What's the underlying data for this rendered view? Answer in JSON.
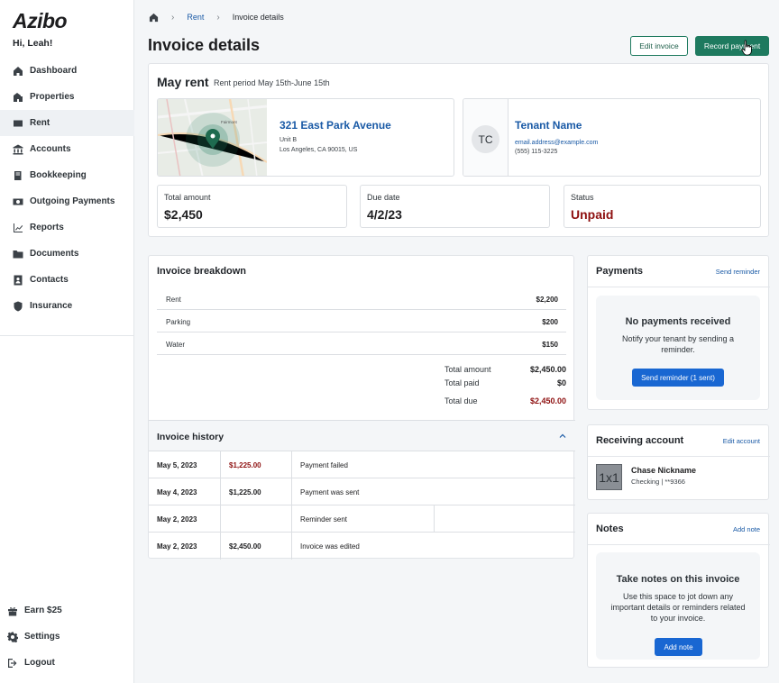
{
  "app": {
    "logo": "Azibo",
    "greeting": "Hi, Leah!"
  },
  "sidebar": {
    "items": [
      {
        "label": "Dashboard",
        "icon": "home-icon"
      },
      {
        "label": "Properties",
        "icon": "building-icon"
      },
      {
        "label": "Rent",
        "icon": "card-icon",
        "active": true
      },
      {
        "label": "Accounts",
        "icon": "bank-icon"
      },
      {
        "label": "Bookkeeping",
        "icon": "book-icon"
      },
      {
        "label": "Outgoing Payments",
        "icon": "money-icon"
      },
      {
        "label": "Reports",
        "icon": "chart-icon"
      },
      {
        "label": "Documents",
        "icon": "folder-icon"
      },
      {
        "label": "Contacts",
        "icon": "contact-icon"
      },
      {
        "label": "Insurance",
        "icon": "shield-icon"
      }
    ],
    "bottom": [
      {
        "label": "Earn $25",
        "icon": "gift-icon"
      },
      {
        "label": "Settings",
        "icon": "gear-icon"
      },
      {
        "label": "Logout",
        "icon": "logout-icon"
      }
    ]
  },
  "breadcrumb": {
    "parent": "Rent",
    "current": "Invoice details"
  },
  "header": {
    "title": "Invoice details",
    "edit_label": "Edit invoice",
    "record_label": "Record payment"
  },
  "summary": {
    "title": "May rent",
    "period": "Rent period May 15th-June 15th",
    "property": {
      "name": "321 East Park Avenue",
      "unit": "Unit B",
      "address": "Los Angeles, CA 90015, US",
      "map_label": "Fairmont"
    },
    "tenant": {
      "initials": "TC",
      "name": "Tenant Name",
      "email": "email.address@example.com",
      "phone": "(555) 115-3225"
    },
    "stats": [
      {
        "label": "Total amount",
        "value": "$2,450"
      },
      {
        "label": "Due date",
        "value": "4/2/23"
      },
      {
        "label": "Status",
        "value": "Unpaid"
      }
    ]
  },
  "breakdown": {
    "title": "Invoice breakdown",
    "items": [
      {
        "name": "Rent",
        "amount": "$2,200"
      },
      {
        "name": "Parking",
        "amount": "$200"
      },
      {
        "name": "Water",
        "amount": "$150"
      }
    ],
    "totals": [
      {
        "label": "Total amount",
        "value": "$2,450.00"
      },
      {
        "label": "Total paid",
        "value": "$0"
      },
      {
        "label": "Total due",
        "value": "$2,450.00"
      }
    ]
  },
  "history": {
    "title": "Invoice history",
    "rows": [
      {
        "date": "May 5, 2023",
        "amount": "$1,225.00",
        "status": "Payment failed"
      },
      {
        "date": "May 4, 2023",
        "amount": "$1,225.00",
        "status": "Payment was sent"
      },
      {
        "date": "May 2, 2023",
        "amount": "",
        "status": "Reminder sent"
      },
      {
        "date": "May 2, 2023",
        "amount": "$2,450.00",
        "status": "Invoice was edited"
      }
    ]
  },
  "payments": {
    "title": "Payments",
    "link": "Send reminder",
    "empty_title": "No payments received",
    "empty_text": "Notify your tenant by sending a reminder.",
    "button": "Send reminder (1 sent)"
  },
  "receiving": {
    "title": "Receiving account",
    "link": "Edit account",
    "icon_text": "1x1",
    "bank": "Chase Nickname",
    "detail": "Checking | **9366"
  },
  "notes": {
    "title": "Notes",
    "link": "Add note",
    "empty_title": "Take notes on this invoice",
    "empty_text": "Use this space to jot down any important details or reminders related to your invoice.",
    "button": "Add note"
  },
  "colors": {
    "brand_green": "#1e7a5f",
    "link_blue": "#1a5aa6",
    "button_blue": "#1967d2",
    "danger_red": "#8e1010"
  }
}
